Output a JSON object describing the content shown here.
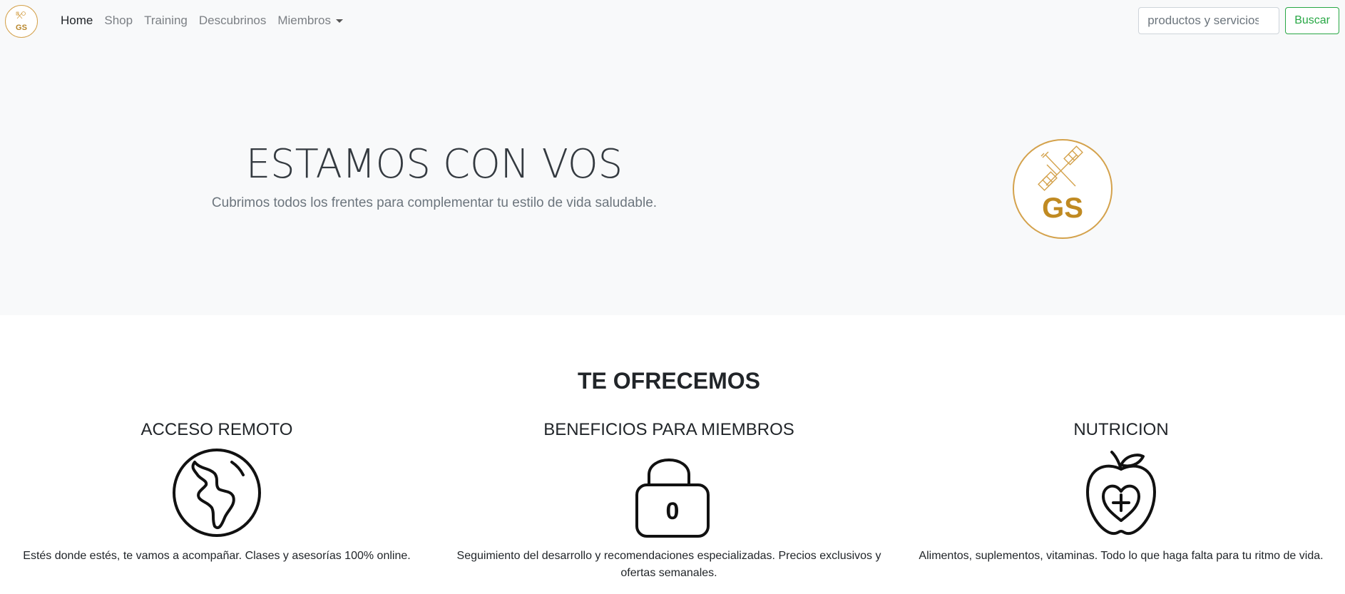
{
  "navbar": {
    "brand_logo_text": "GS",
    "links": [
      {
        "label": "Home",
        "active": true
      },
      {
        "label": "Shop",
        "active": false
      },
      {
        "label": "Training",
        "active": false
      },
      {
        "label": "Descubrinos",
        "active": false
      },
      {
        "label": "Miembros",
        "active": false,
        "dropdown": true
      }
    ],
    "search_placeholder": "productos y servicios",
    "search_button": "Buscar"
  },
  "hero": {
    "title": "ESTAMOS CON VOS",
    "subtitle": "Cubrimos todos los frentes para complementar tu estilo de vida saludable.",
    "logo_text": "GS"
  },
  "offer": {
    "title": "TE OFRECEMOS",
    "items": [
      {
        "title": "ACCESO REMOTO",
        "icon": "globe-icon",
        "text": "Estés donde estés, te vamos a acompañar. Clases y asesorías 100% online."
      },
      {
        "title": "BENEFICIOS PARA MIEMBROS",
        "icon": "unlocked-padlock-icon",
        "text": "Seguimiento del desarrollo y recomendaciones especializadas. Precios exclusivos y ofertas semanales.",
        "icon_label": "0"
      },
      {
        "title": "NUTRICION",
        "icon": "apple-heart-plus-icon",
        "text": "Alimentos, suplementos, vitaminas. Todo lo que haga falta para tu ritmo de vida."
      }
    ]
  },
  "colors": {
    "navbar_bg": "#f8f9fa",
    "hero_bg": "#f8f9fa",
    "brand_gold": "#d4a24c",
    "search_button_green": "#28a745"
  }
}
